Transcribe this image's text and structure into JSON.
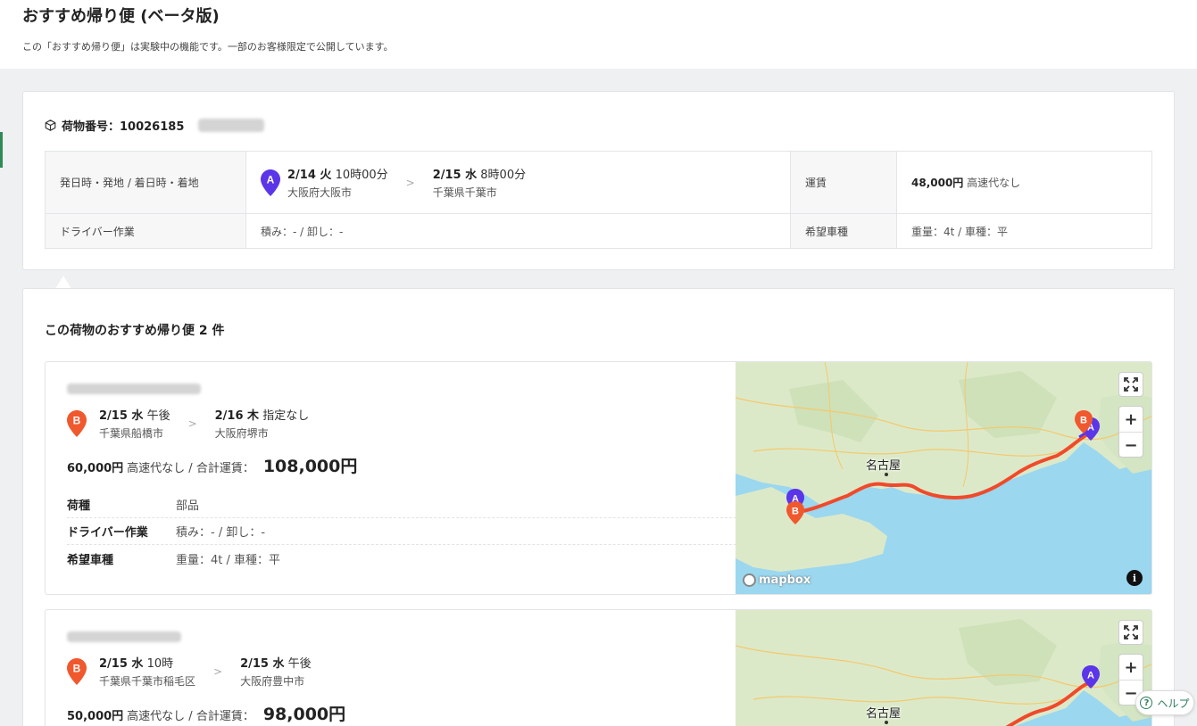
{
  "header": {
    "title": "おすすめ帰り便 (ベータ版)",
    "description": "この「おすすめ帰り便」は実験中の機能です。一部のお客様限定で公開しています。"
  },
  "cargo": {
    "number_label": "荷物番号：10026185",
    "table": {
      "route_header": "発日時・発地 / 着日時・着地",
      "depart_date": "2/14 火",
      "depart_time": "10時00分",
      "depart_place": "大阪府大阪市",
      "arrive_date": "2/15 水",
      "arrive_time": "8時00分",
      "arrive_place": "千葉県千葉市",
      "fare_header": "運賃",
      "fare_value": "48,000円",
      "fare_note": "高速代なし",
      "driver_header": "ドライバー作業",
      "driver_value": "積み：- / 卸し：-",
      "vehicle_header": "希望車種",
      "vehicle_value": "重量：4t / 車種：平",
      "pin_label": "A"
    }
  },
  "list": {
    "title": "この荷物のおすすめ帰り便 2 件",
    "results": [
      {
        "pin_label": "B",
        "depart_date": "2/15 水",
        "depart_time": "午後",
        "depart_place": "千葉県船橋市",
        "arrive_date": "2/16 木",
        "arrive_time": "指定なし",
        "arrive_place": "大阪府堺市",
        "price": "60,000円",
        "price_note": "高速代なし / 合計運賃：",
        "total": "108,000円",
        "rows": [
          {
            "k": "荷種",
            "v": "部品"
          },
          {
            "k": "ドライバー作業",
            "v": "積み：- / 卸し：-"
          },
          {
            "k": "希望車種",
            "v": "重量：4t / 車種：平"
          }
        ],
        "map_city": "名古屋"
      },
      {
        "pin_label": "B",
        "depart_date": "2/15 水",
        "depart_time": "10時",
        "depart_place": "千葉県千葉市稲毛区",
        "arrive_date": "2/15 水",
        "arrive_time": "午後",
        "arrive_place": "大阪府豊中市",
        "price": "50,000円",
        "price_note": "高速代なし / 合計運賃：",
        "total": "98,000円",
        "map_city": "名古屋"
      }
    ]
  },
  "map": {
    "logo": "mapbox",
    "zoom_in": "+",
    "zoom_out": "−",
    "info": "i",
    "pin_a": "A",
    "pin_b": "B"
  },
  "help": {
    "label": "ヘルプ",
    "icon": "?"
  },
  "colors": {
    "pin_a": "#5b35e8",
    "pin_b": "#f0582e",
    "route": "#f04a2a",
    "accent": "#2e8b57"
  }
}
